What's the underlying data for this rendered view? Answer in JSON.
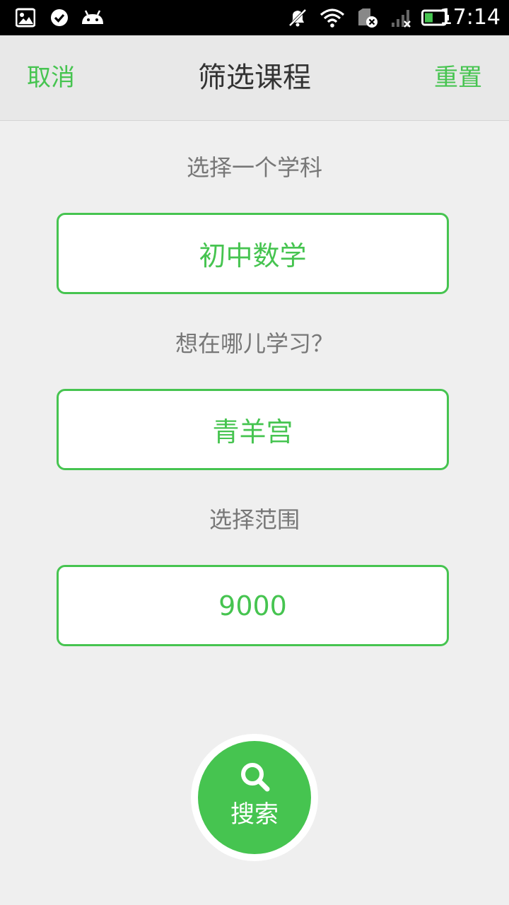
{
  "status_bar": {
    "time": "17:14",
    "icons": [
      "image-icon",
      "check-circle-icon",
      "android-icon",
      "mute-icon",
      "wifi-icon",
      "sim-disabled-icon",
      "signal-icon",
      "battery-icon"
    ]
  },
  "header": {
    "cancel_label": "取消",
    "title": "筛选课程",
    "reset_label": "重置"
  },
  "form": {
    "subject_label": "选择一个学科",
    "subject_value": "初中数学",
    "location_label": "想在哪儿学习？",
    "location_value": "青羊宫",
    "range_label": "选择范围",
    "range_value": "9000"
  },
  "search_button": {
    "label": "搜索"
  },
  "colors": {
    "accent": "#46c450",
    "background": "#efefef",
    "header_bg": "#e8e8e8",
    "label_gray": "#777777"
  }
}
